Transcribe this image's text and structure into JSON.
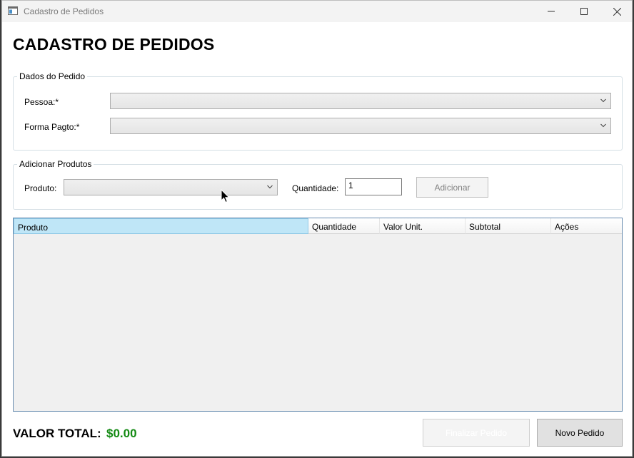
{
  "window": {
    "title": "Cadastro de Pedidos"
  },
  "header": {
    "title": "CADASTRO DE PEDIDOS"
  },
  "order_group": {
    "label": "Dados do Pedido",
    "pessoa_label": "Pessoa:*",
    "pessoa_value": "",
    "forma_pagto_label": "Forma Pagto:*",
    "forma_pagto_value": ""
  },
  "products_group": {
    "label": "Adicionar Produtos",
    "produto_label": "Produto:",
    "produto_value": "",
    "quantidade_label": "Quantidade:",
    "quantidade_value": "1",
    "add_button": "Adicionar"
  },
  "grid": {
    "columns": [
      "Produto",
      "Quantidade",
      "Valor Unit.",
      "Subtotal",
      "Ações"
    ],
    "rows": []
  },
  "footer": {
    "total_label": "VALOR TOTAL:",
    "total_value": "$0.00",
    "finalizar_button": "Finalizar Pedido",
    "novo_button": "Novo Pedido"
  },
  "colors": {
    "total_value": "#138a13",
    "selected_header": "#bfe6f7",
    "grid_border": "#688caf"
  }
}
